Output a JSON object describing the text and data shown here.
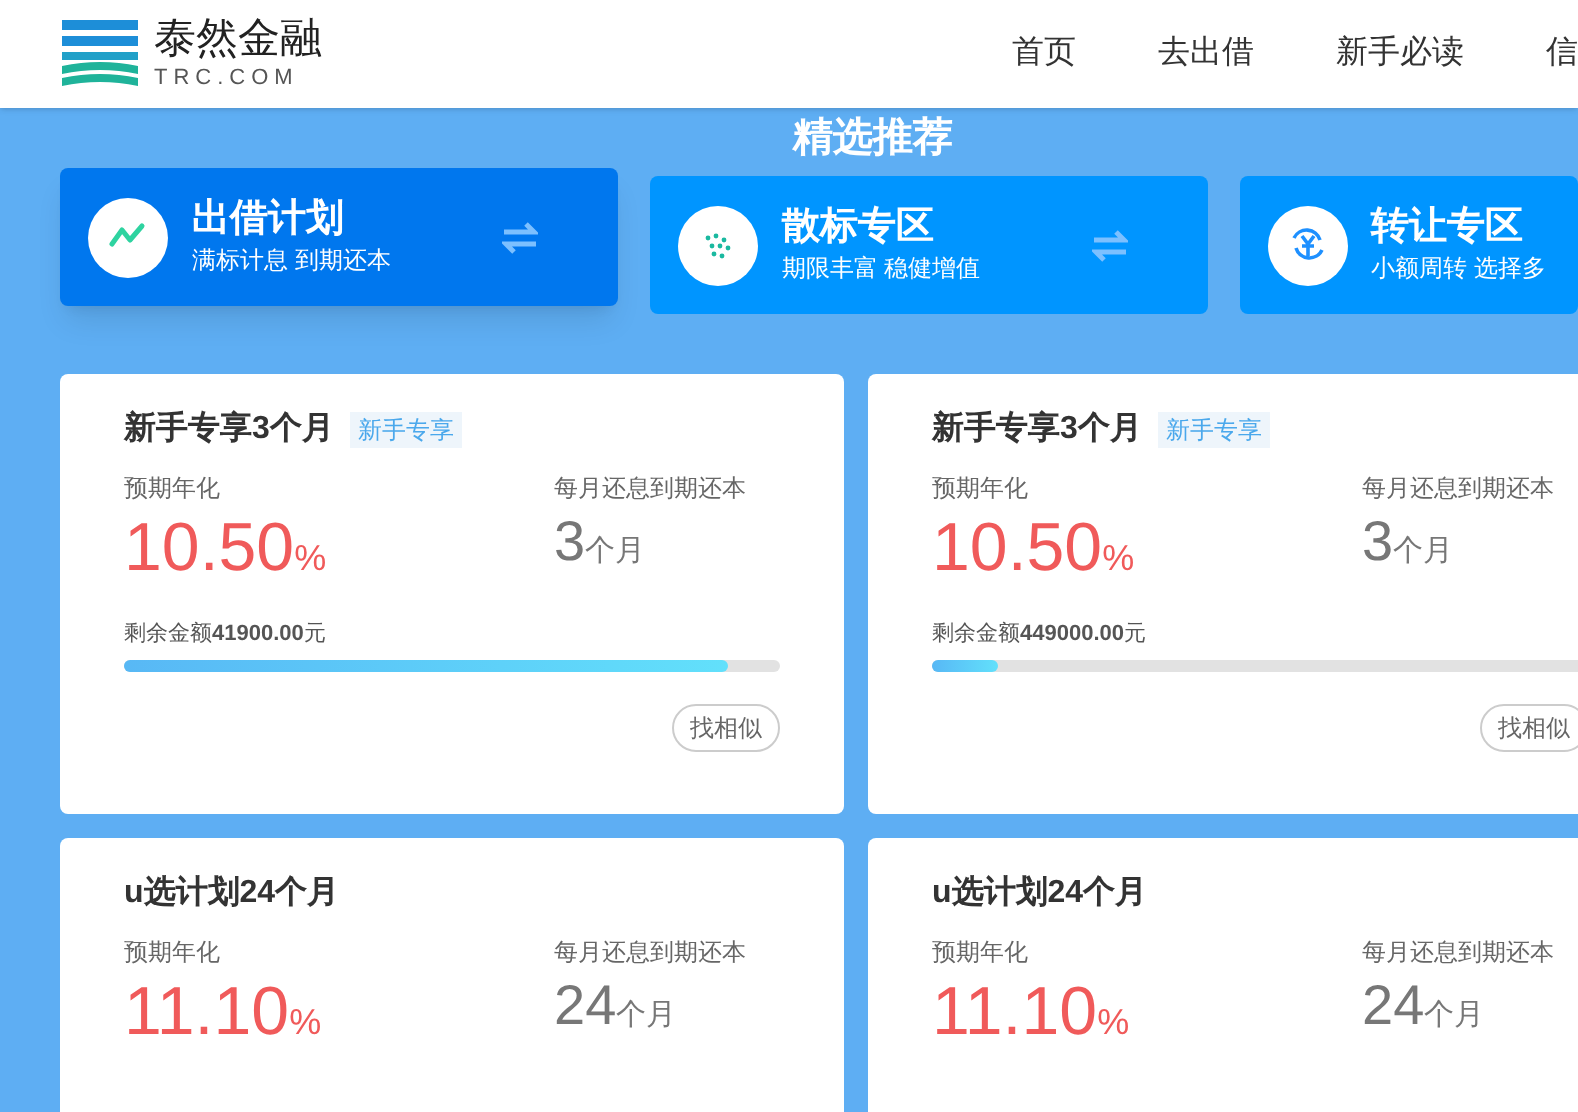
{
  "header": {
    "logo_name": "泰然金融",
    "logo_domain": "TRC.COM",
    "nav": [
      {
        "label": "首页"
      },
      {
        "label": "去出借"
      },
      {
        "label": "新手必读"
      },
      {
        "label": "信"
      }
    ]
  },
  "section_title": "精选推荐",
  "categories": [
    {
      "title": "出借计划",
      "subtitle": "满标计息 到期还本",
      "selected": true,
      "kind": "trend"
    },
    {
      "title": "散标专区",
      "subtitle": "期限丰富 稳健增值",
      "selected": false,
      "kind": "dots"
    },
    {
      "title": "转让专区",
      "subtitle": "小额周转 选择多",
      "selected": false,
      "kind": "yen"
    }
  ],
  "products": [
    {
      "title": "新手专享3个月",
      "tag": "新手专享",
      "rate_label": "预期年化",
      "rate": "10.50",
      "rate_unit": "%",
      "term_label": "每月还息到期还本",
      "term": "3",
      "term_unit": "个月",
      "remaining_label": "剩余金额",
      "remaining": "41900.00",
      "remaining_unit": "元",
      "level": 0.92,
      "action": "找相似"
    },
    {
      "title": "新手专享3个月",
      "tag": "新手专享",
      "rate_label": "预期年化",
      "rate": "10.50",
      "rate_unit": "%",
      "term_label": "每月还息到期还本",
      "term": "3",
      "term_unit": "个月",
      "remaining_label": "剩余金额",
      "remaining": "449000.00",
      "remaining_unit": "元",
      "level": 0.1,
      "action": "找相似"
    },
    {
      "title": "u选计划24个月",
      "rate_label": "预期年化",
      "rate": "11.10",
      "rate_unit": "%",
      "term_label": "每月还息到期还本",
      "term": "24",
      "term_unit": "个月"
    },
    {
      "title": "u选计划24个月",
      "rate_label": "预期年化",
      "rate": "11.10",
      "rate_unit": "%",
      "term_label": "每月还息到期还本",
      "term": "24",
      "term_unit": "个月"
    }
  ]
}
